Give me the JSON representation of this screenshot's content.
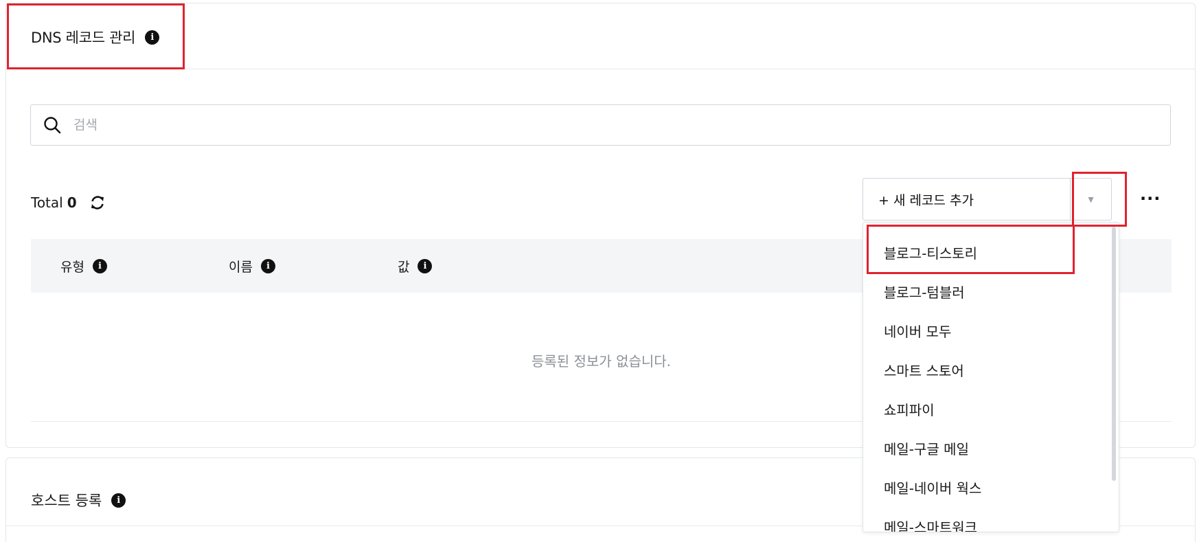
{
  "dns_section": {
    "title": "DNS 레코드 관리",
    "search_placeholder": "검색",
    "total_label": "Total",
    "total_count": "0",
    "add_record_label": "+ 새 레코드 추가",
    "caret": "▼",
    "more": "···",
    "columns": [
      "유형",
      "이름",
      "값"
    ],
    "empty_message": "등록된 정보가 없습니다."
  },
  "dropdown": {
    "items": [
      "블로그-티스토리",
      "블로그-텀블러",
      "네이버 모두",
      "스마트 스토어",
      "쇼피파이",
      "메일-구글 메일",
      "메일-네이버 웍스",
      "메일-스마트워크"
    ]
  },
  "host_section": {
    "title": "호스트 등록"
  },
  "colors": {
    "highlight": "#e0222e",
    "table_header_bg": "#f4f5f7",
    "border": "#cfd4da"
  }
}
